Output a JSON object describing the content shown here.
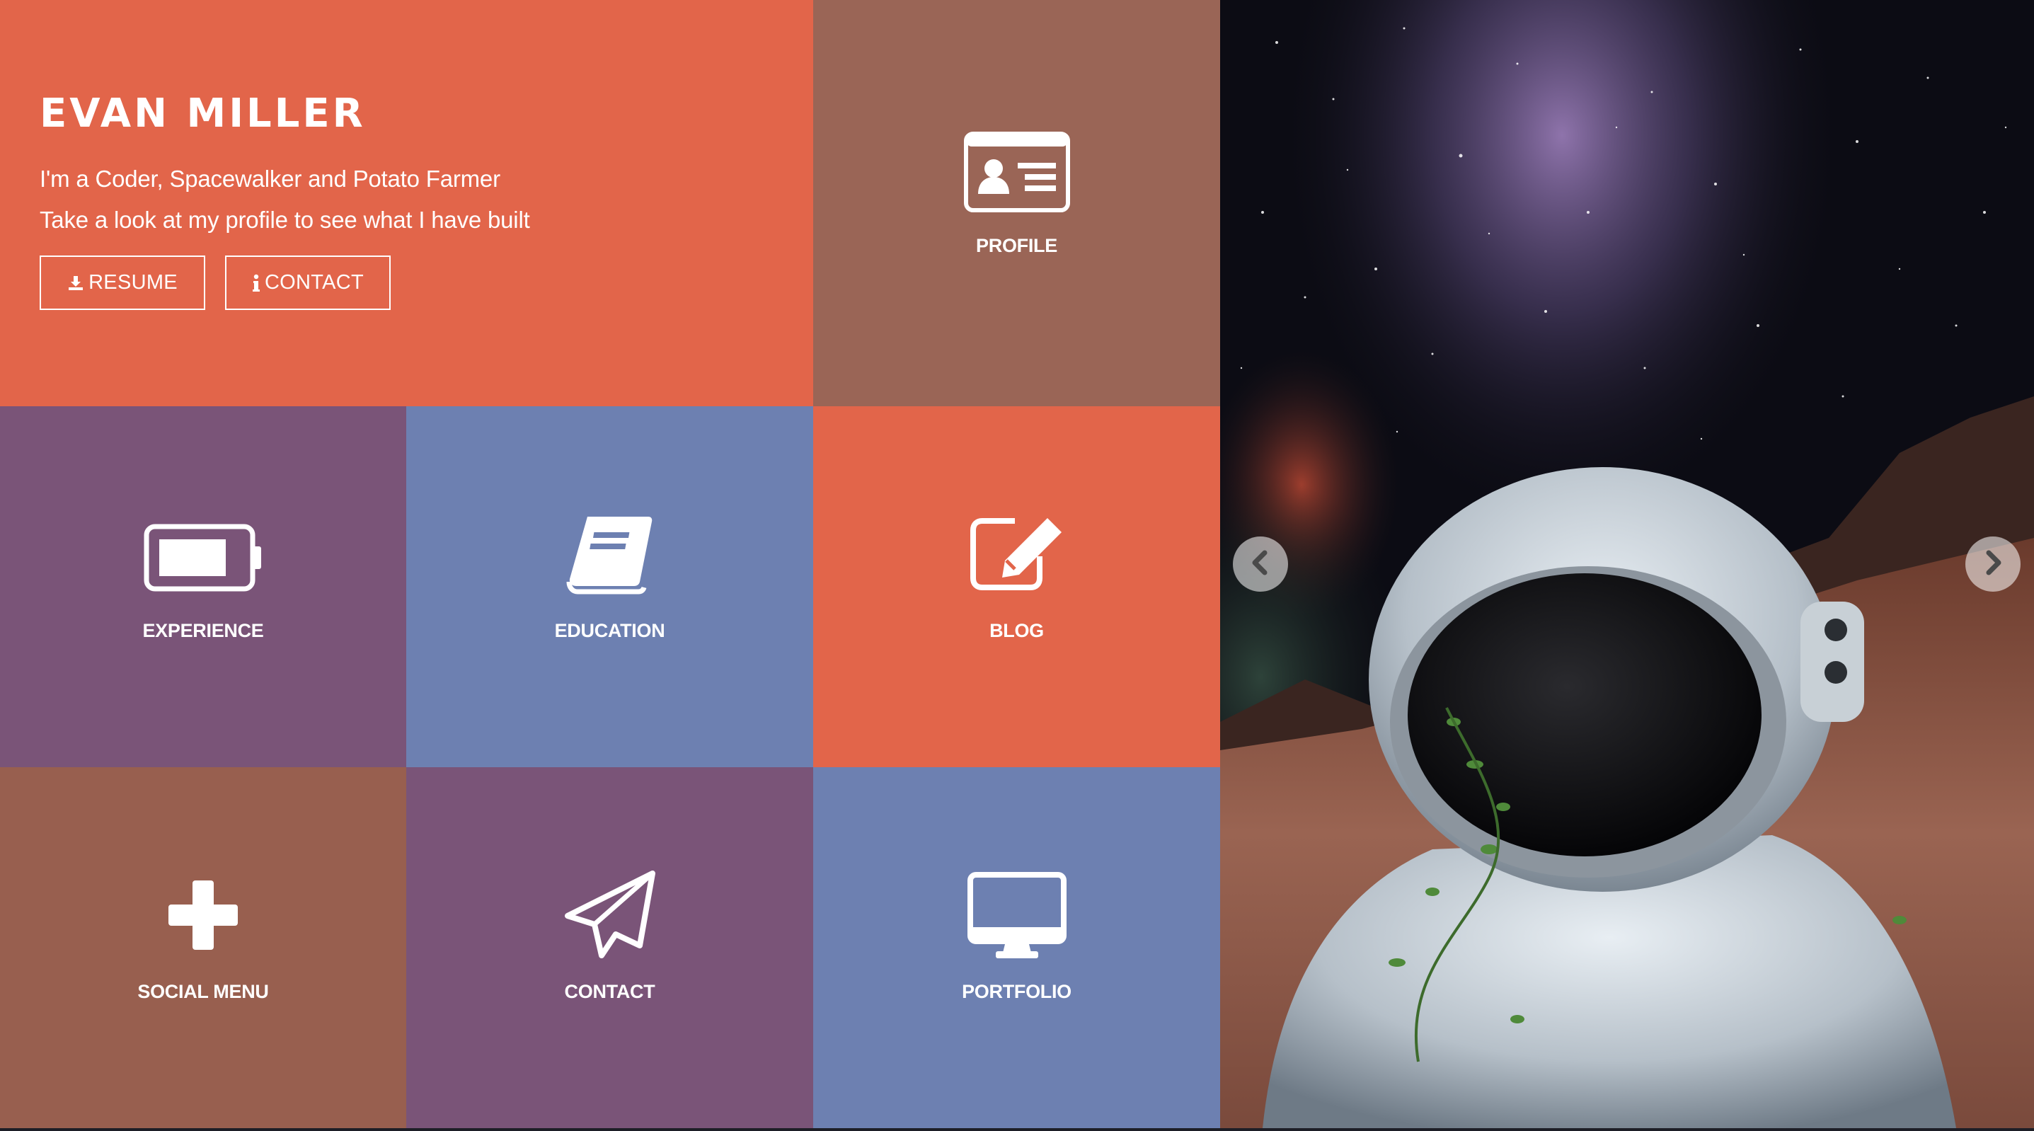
{
  "intro": {
    "name": "EVAN MILLER",
    "tagline": "I'm a Coder, Spacewalker and Potato Farmer",
    "subline": "Take a look at my profile to see what I have built",
    "resume_label": "RESUME",
    "contact_label": "CONTACT"
  },
  "tiles": {
    "profile": "PROFILE",
    "experience": "EXPERIENCE",
    "education": "EDUCATION",
    "blog": "BLOG",
    "social": "SOCIAL MENU",
    "contact": "CONTACT",
    "portfolio": "PORTFOLIO"
  },
  "icons": {
    "profile": "id-card-icon",
    "experience": "battery-icon",
    "education": "book-icon",
    "blog": "edit-icon",
    "social": "plus-icon",
    "contact": "paper-plane-icon",
    "portfolio": "monitor-icon",
    "resume": "download-icon",
    "contact_btn": "info-icon",
    "prev": "chevron-left-icon",
    "next": "chevron-right-icon"
  },
  "colors": {
    "orange": "#e2654a",
    "brown": "#9a6556",
    "purple": "#7a5478",
    "blue": "#6d80b1"
  }
}
